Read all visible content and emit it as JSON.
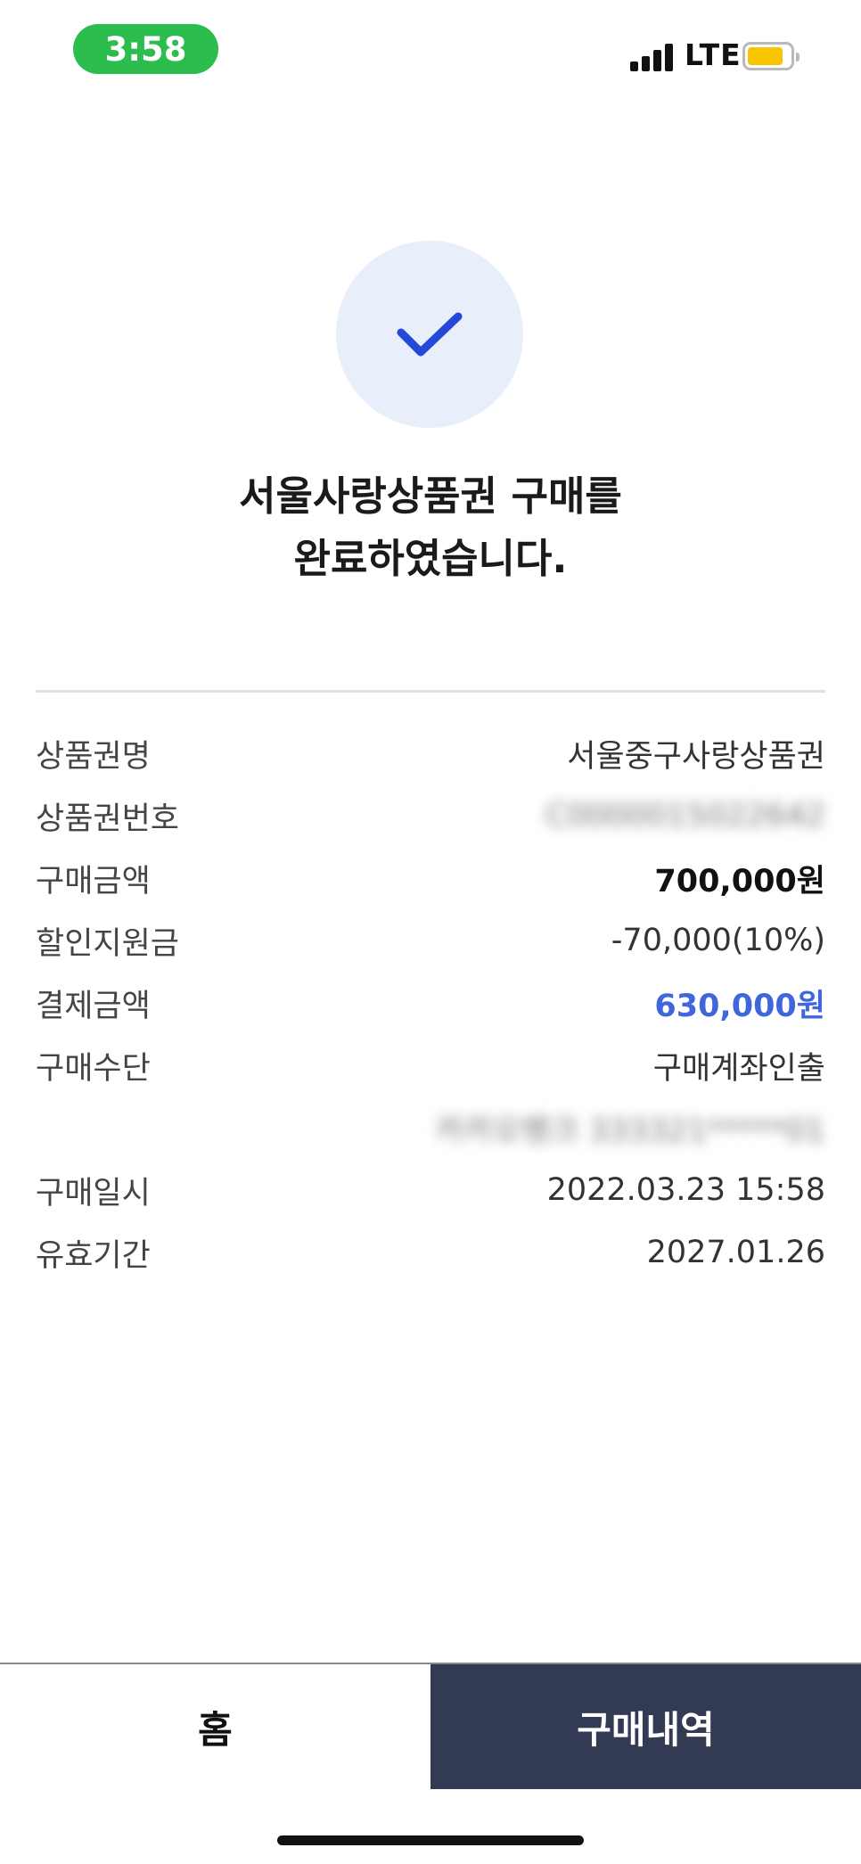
{
  "status_bar": {
    "time": "3:58",
    "network": "LTE",
    "battery_icon": "battery-icon",
    "signal_icon": "cellular-signal-icon"
  },
  "success": {
    "icon": "checkmark-icon",
    "title_line1": "서울사랑상품권 구매를",
    "title_line2": "완료하였습니다."
  },
  "details": {
    "voucher_name": {
      "label": "상품권명",
      "value": "서울중구사랑상품권"
    },
    "voucher_number": {
      "label": "상품권번호",
      "value": "C0000015022642"
    },
    "purchase_amount": {
      "label": "구매금액",
      "value": "700,000원"
    },
    "discount_support": {
      "label": "할인지원금",
      "value": "-70,000(10%)"
    },
    "payment_amount": {
      "label": "결제금액",
      "value": "630,000원"
    },
    "payment_method": {
      "label": "구매수단",
      "value": "구매계좌인출"
    },
    "account": {
      "value": "카카오뱅크 333321*****01"
    },
    "purchase_datetime": {
      "label": "구매일시",
      "value": "2022.03.23 15:58"
    },
    "valid_until": {
      "label": "유효기간",
      "value": "2027.01.26"
    }
  },
  "bottom": {
    "home_label": "홈",
    "history_label": "구매내역"
  },
  "colors": {
    "accent_blue": "#3f67db",
    "check_blue": "#2449d8",
    "check_bg": "#e8effb",
    "button_dark": "#333a54",
    "status_green": "#2dbd4e"
  }
}
